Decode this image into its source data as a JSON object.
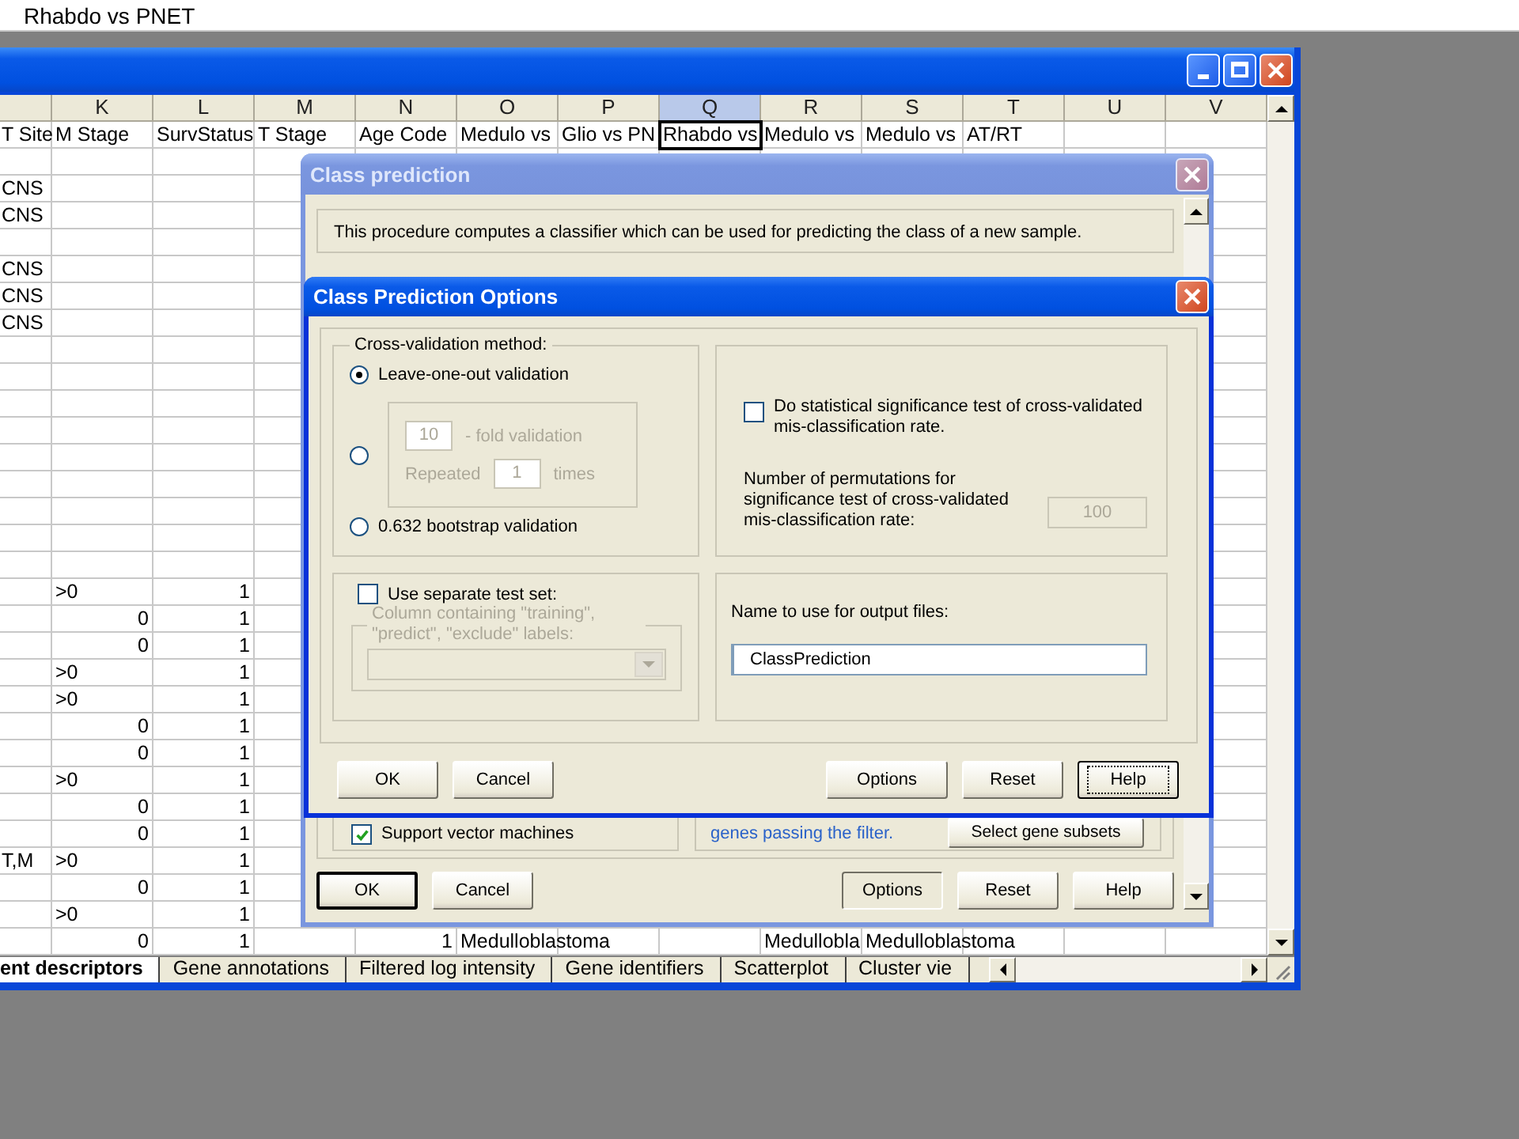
{
  "formula_bar": {
    "value": "Rhabdo vs PNET"
  },
  "workbook": {
    "columns": [
      {
        "selected": false
      },
      {
        "letter": "K",
        "selected": false
      },
      {
        "letter": "L",
        "selected": false
      },
      {
        "letter": "M",
        "selected": false
      },
      {
        "letter": "N",
        "selected": false
      },
      {
        "letter": "O",
        "selected": false
      },
      {
        "letter": "P",
        "selected": false
      },
      {
        "letter": "Q",
        "selected": true
      },
      {
        "letter": "R",
        "selected": false
      },
      {
        "letter": "S",
        "selected": false
      },
      {
        "letter": "T",
        "selected": false
      },
      {
        "letter": "U",
        "selected": false
      },
      {
        "letter": "V",
        "selected": false
      }
    ],
    "header_row": [
      {
        "text": "T Site",
        "active": false
      },
      {
        "text": "M Stage",
        "active": false
      },
      {
        "text": "SurvStatus",
        "active": false
      },
      {
        "text": "T Stage",
        "active": false
      },
      {
        "text": "Age Code",
        "active": false
      },
      {
        "text": "Medulo vs",
        "active": false
      },
      {
        "text": "Glio vs PN",
        "active": false
      },
      {
        "text": "Rhabdo vs",
        "active": true
      },
      {
        "text": "Medulo vs",
        "active": false
      },
      {
        "text": "Medulo vs",
        "active": false
      },
      {
        "text": "AT/RT",
        "active": false
      }
    ],
    "rows": [
      {},
      {
        "cells": [
          {
            "text": "CNS",
            "kind": "text"
          }
        ]
      },
      {
        "cells": [
          {
            "text": "CNS",
            "kind": "text"
          }
        ]
      },
      {},
      {
        "cells": [
          {
            "text": "CNS",
            "kind": "text"
          }
        ]
      },
      {
        "cells": [
          {
            "text": "CNS",
            "kind": "text"
          }
        ]
      },
      {
        "cells": [
          {
            "text": "CNS",
            "kind": "text"
          }
        ]
      },
      {},
      {},
      {},
      {},
      {},
      {},
      {},
      {},
      {},
      {
        "cells": [
          null,
          {
            "text": ">0",
            "kind": "text"
          },
          {
            "text": "1",
            "kind": "number"
          }
        ]
      },
      {
        "cells": [
          null,
          {
            "text": "0",
            "kind": "number"
          },
          {
            "text": "1",
            "kind": "number"
          }
        ]
      },
      {
        "cells": [
          null,
          {
            "text": "0",
            "kind": "number"
          },
          {
            "text": "1",
            "kind": "number"
          }
        ]
      },
      {
        "cells": [
          null,
          {
            "text": ">0",
            "kind": "text"
          },
          {
            "text": "1",
            "kind": "number"
          }
        ]
      },
      {
        "cells": [
          null,
          {
            "text": ">0",
            "kind": "text"
          },
          {
            "text": "1",
            "kind": "number"
          }
        ]
      },
      {
        "cells": [
          null,
          {
            "text": "0",
            "kind": "number"
          },
          {
            "text": "1",
            "kind": "number"
          }
        ]
      },
      {
        "cells": [
          null,
          {
            "text": "0",
            "kind": "number"
          },
          {
            "text": "1",
            "kind": "number"
          }
        ]
      },
      {
        "cells": [
          null,
          {
            "text": ">0",
            "kind": "text"
          },
          {
            "text": "1",
            "kind": "number"
          }
        ]
      },
      {
        "cells": [
          null,
          {
            "text": "0",
            "kind": "number"
          },
          {
            "text": "1",
            "kind": "number"
          }
        ]
      },
      {
        "cells": [
          null,
          {
            "text": "0",
            "kind": "number"
          },
          {
            "text": "1",
            "kind": "number"
          }
        ]
      },
      {
        "cells": [
          {
            "text": "T,M",
            "kind": "text"
          },
          {
            "text": ">0",
            "kind": "text"
          },
          {
            "text": "1",
            "kind": "number"
          }
        ]
      },
      {
        "cells": [
          null,
          {
            "text": "0",
            "kind": "number"
          },
          {
            "text": "1",
            "kind": "number"
          }
        ]
      },
      {
        "cells": [
          null,
          {
            "text": ">0",
            "kind": "text"
          },
          {
            "text": "1",
            "kind": "number"
          }
        ]
      },
      {
        "cells": [
          null,
          {
            "text": "0",
            "kind": "number"
          },
          {
            "text": "1",
            "kind": "number"
          },
          null,
          {
            "text": "1",
            "kind": "number"
          },
          {
            "text": "Medulloblastoma",
            "kind": "text"
          },
          null,
          null,
          {
            "text": "Medullobla",
            "kind": "text"
          },
          {
            "text": "Medulloblastoma",
            "kind": "text"
          }
        ]
      }
    ],
    "tabs": [
      {
        "label": "ent descriptors",
        "selected": true
      },
      {
        "label": "Gene annotations",
        "selected": false
      },
      {
        "label": "Filtered log intensity",
        "selected": false
      },
      {
        "label": "Gene identifiers",
        "selected": false
      },
      {
        "label": "Scatterplot",
        "selected": false
      },
      {
        "label": "Cluster vie",
        "selected": false
      }
    ]
  },
  "class_prediction": {
    "title": "Class prediction",
    "active": false,
    "intro": "This procedure computes a classifier which can be used for predicting the class of a new sample.",
    "methods": [
      {
        "label": "Support vector machines",
        "checked": true
      }
    ],
    "gene_note": "genes passing the filter.",
    "select_button": "Select gene subsets",
    "buttons": [
      {
        "label": "OK",
        "default": true,
        "pressed": false
      },
      {
        "label": "Cancel",
        "default": false,
        "pressed": false
      },
      {
        "label": "Options",
        "default": false,
        "pressed": true
      },
      {
        "label": "Reset",
        "default": false,
        "pressed": false
      },
      {
        "label": "Help",
        "default": false,
        "pressed": false
      }
    ]
  },
  "options_dialog": {
    "title": "Class Prediction Options",
    "active": true,
    "cv_legend": "Cross-validation method:",
    "cv_options": [
      {
        "kind": "simple",
        "label": "Leave-one-out validation",
        "selected": true
      },
      {
        "kind": "kfold",
        "selected": false,
        "disabled": true,
        "fold_value": "10",
        "fold_label": "- fold validation",
        "repeat_label": "Repeated",
        "repeat_value": "1",
        "times_label": "times"
      },
      {
        "kind": "simple",
        "label": "0.632 bootstrap validation",
        "selected": false
      }
    ],
    "significance": {
      "label": "Do statistical significance test of cross-validated mis-classification rate.",
      "checked": false,
      "permutations_label": "Number of permutations for significance test of cross-validated mis-classification rate:",
      "permutations_value": "100",
      "disabled": true
    },
    "test_set": {
      "label": "Use separate test set:",
      "checked": false,
      "column_legend": "Column containing \"training\", \"predict\", \"exclude\" labels:",
      "disabled": true
    },
    "output": {
      "label": "Name to use for output files:",
      "value": "ClassPrediction"
    },
    "buttons": [
      {
        "label": "OK",
        "focused": false
      },
      {
        "label": "Cancel",
        "focused": false
      },
      {
        "label": "Options",
        "focused": false
      },
      {
        "label": "Reset",
        "focused": false
      },
      {
        "label": "Help",
        "focused": true
      }
    ]
  }
}
